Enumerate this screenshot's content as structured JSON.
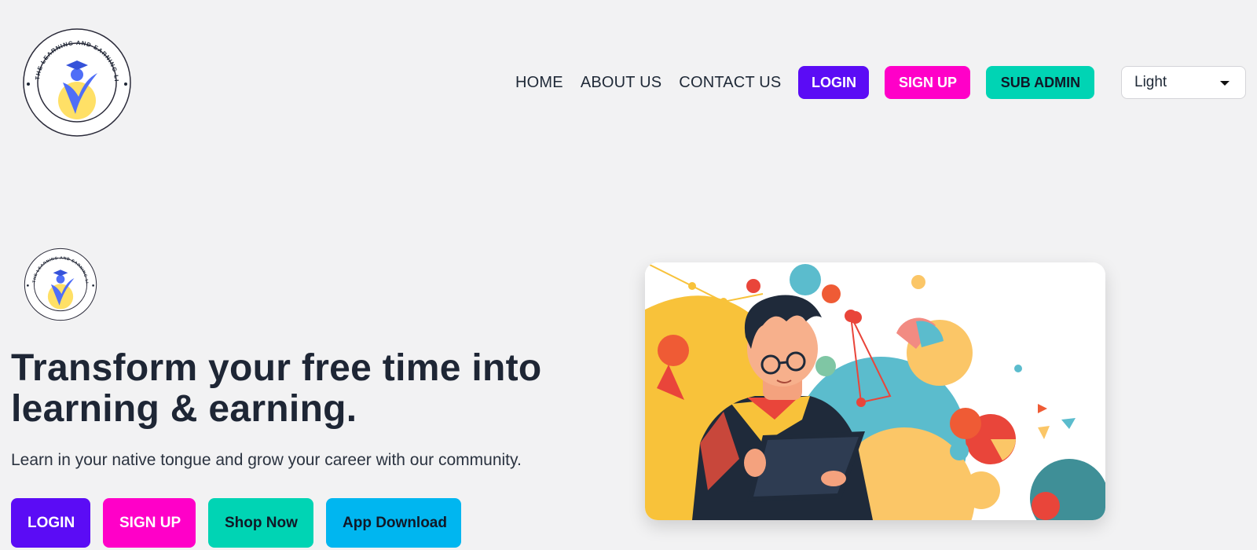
{
  "brand": {
    "name": "THE LEARNING AND EARNING LIMITED",
    "logo_alt": "The Learning and Earning Limited logo"
  },
  "nav": {
    "home": "HOME",
    "about": "ABOUT US",
    "contact": "CONTACT US",
    "login": "LOGIN",
    "signup": "SIGN UP",
    "sub_admin": "SUB ADMIN"
  },
  "theme_select": {
    "value": "Light",
    "options": [
      "Light"
    ]
  },
  "hero": {
    "title": "Transform your free time into learning & earning.",
    "subtitle": "Learn in your native tongue and grow your career with our community.",
    "buttons": {
      "login": "LOGIN",
      "signup": "SIGN UP",
      "shop": "Shop Now",
      "app": "App Download"
    },
    "image_alt": "Illustration of a student with a tablet surrounded by colorful shapes"
  },
  "colors": {
    "background": "#f2f2f3",
    "purple": "#5b0cf5",
    "pink": "#ff00c8",
    "teal": "#00d4b4",
    "blue": "#00b6f0",
    "text": "#1f2937"
  }
}
